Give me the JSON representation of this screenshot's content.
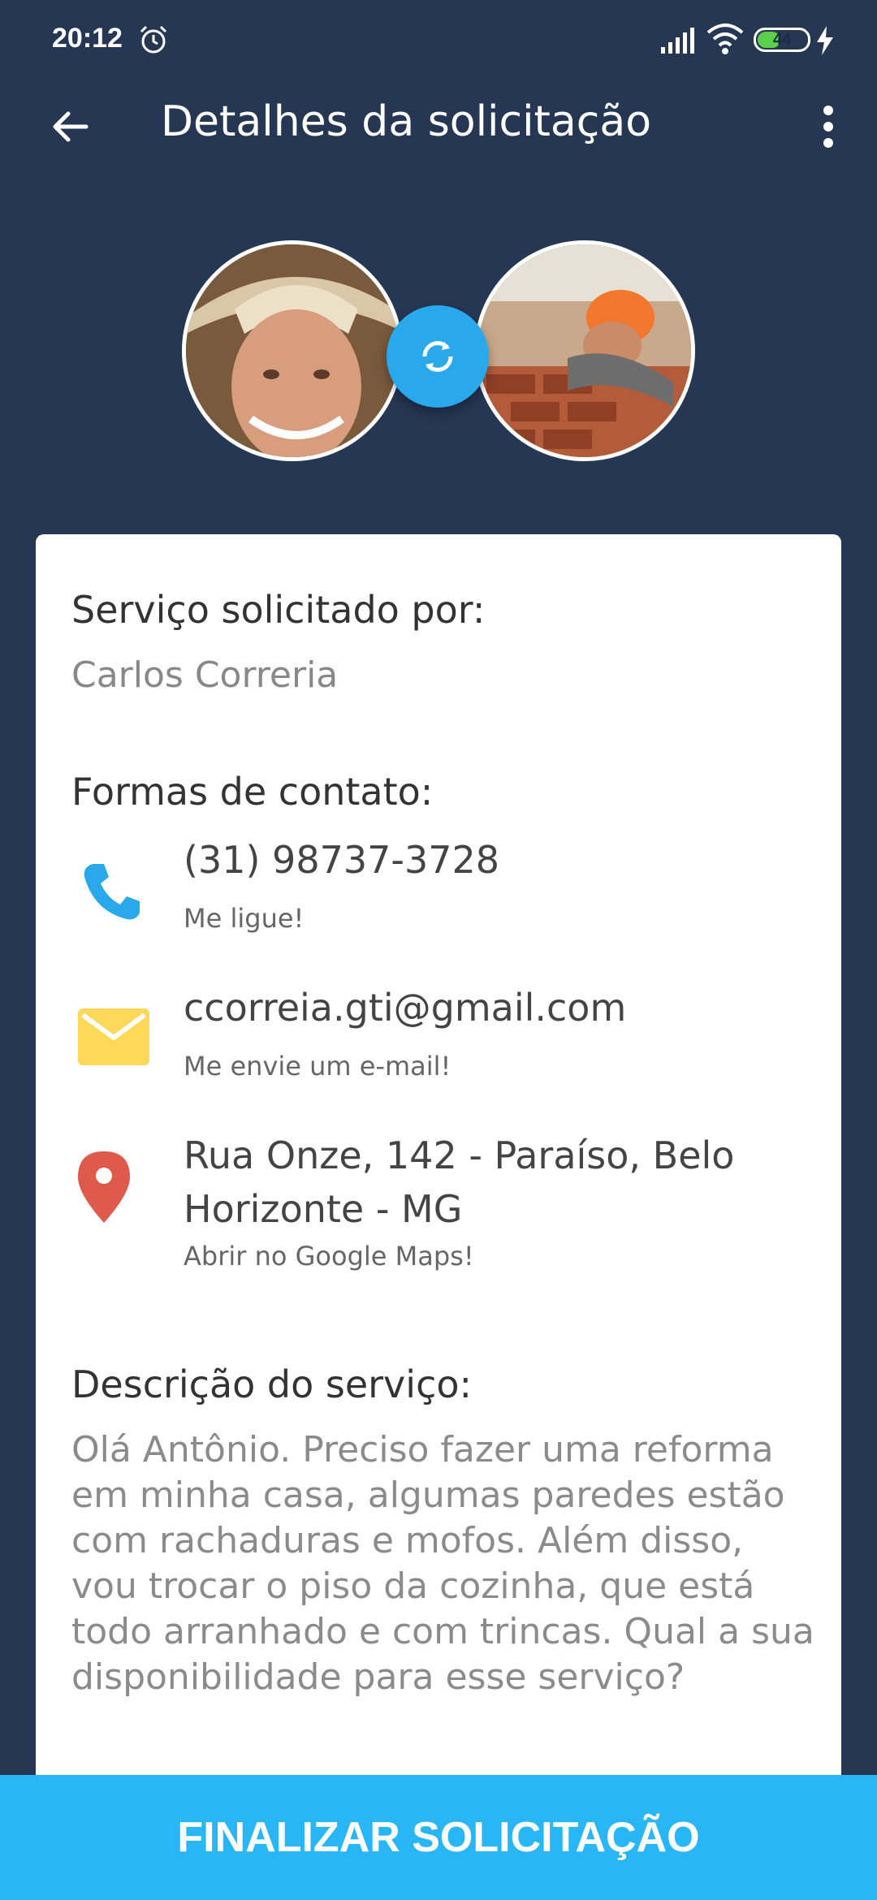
{
  "status_bar": {
    "time": "20:12",
    "battery": "44"
  },
  "app_bar": {
    "title": "Detalhes da solicitação",
    "back_icon": "arrow-left-icon",
    "menu_icon": "more-vertical-icon"
  },
  "avatars": {
    "left": "requester-photo",
    "right": "worker-photo",
    "swap_icon": "sync-icon",
    "swap_color": "#29a9ec"
  },
  "request": {
    "requested_by_label": "Serviço solicitado por:",
    "requested_by_name": "Carlos Correria",
    "contact_label": "Formas de contato:",
    "phone": {
      "value": "(31) 98737-3728",
      "hint": "Me ligue!",
      "icon": "phone-icon",
      "color": "#29a9ec"
    },
    "email": {
      "value": "ccorreia.gti@gmail.com",
      "hint": "Me envie um e-mail!",
      "icon": "envelope-icon",
      "color": "#ffd85a"
    },
    "address": {
      "value": "Rua Onze, 142 - Paraíso, Belo Horizonte - MG",
      "hint": "Abrir no Google Maps!",
      "icon": "map-pin-icon",
      "color": "#e05a4b"
    },
    "description_label": "Descrição do serviço:",
    "description": "Olá Antônio. Preciso fazer uma reforma em minha casa, algumas paredes estão com rachaduras e mofos. Além disso, vou trocar o piso da cozinha, que está todo arranhado e com trincas. Qual a sua disponibilidade para esse serviço?"
  },
  "actions": {
    "finalize_label": "FINALIZAR SOLICITAÇÃO",
    "finalize_color": "#29b6f6"
  },
  "colors": {
    "background": "#263754",
    "card": "#ffffff"
  }
}
